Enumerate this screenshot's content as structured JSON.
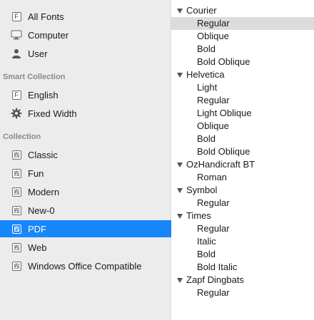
{
  "sidebar": {
    "library_items": [
      {
        "label": "All Fonts",
        "icon": "font-file-icon"
      },
      {
        "label": "Computer",
        "icon": "monitor-icon"
      },
      {
        "label": "User",
        "icon": "user-icon"
      }
    ],
    "smart_collection_header": "Smart Collection",
    "smart_items": [
      {
        "label": "English",
        "icon": "font-file-icon"
      },
      {
        "label": "Fixed Width",
        "icon": "gear-icon"
      }
    ],
    "collection_header": "Collection",
    "collection_items": [
      {
        "label": "Classic",
        "icon": "collection-icon"
      },
      {
        "label": "Fun",
        "icon": "collection-icon"
      },
      {
        "label": "Modern",
        "icon": "collection-icon"
      },
      {
        "label": "New-0",
        "icon": "collection-icon"
      },
      {
        "label": "PDF",
        "icon": "collection-icon",
        "selected": true
      },
      {
        "label": "Web",
        "icon": "collection-icon"
      },
      {
        "label": "Windows Office Compatible",
        "icon": "collection-icon"
      }
    ]
  },
  "font_list": {
    "families": [
      {
        "name": "Courier",
        "faces": [
          "Regular",
          "Oblique",
          "Bold",
          "Bold Oblique"
        ]
      },
      {
        "name": "Helvetica",
        "faces": [
          "Light",
          "Regular",
          "Light Oblique",
          "Oblique",
          "Bold",
          "Bold Oblique"
        ]
      },
      {
        "name": "OzHandicraft BT",
        "faces": [
          "Roman"
        ]
      },
      {
        "name": "Symbol",
        "faces": [
          "Regular"
        ]
      },
      {
        "name": "Times",
        "faces": [
          "Regular",
          "Italic",
          "Bold",
          "Bold Italic"
        ]
      },
      {
        "name": "Zapf Dingbats",
        "faces": [
          "Regular"
        ]
      }
    ],
    "selected": {
      "family": "Courier",
      "face": "Regular"
    }
  },
  "colors": {
    "selection_blue": "#1786f8",
    "row_highlight": "#dcdcdc",
    "sidebar_bg": "#ececec"
  }
}
